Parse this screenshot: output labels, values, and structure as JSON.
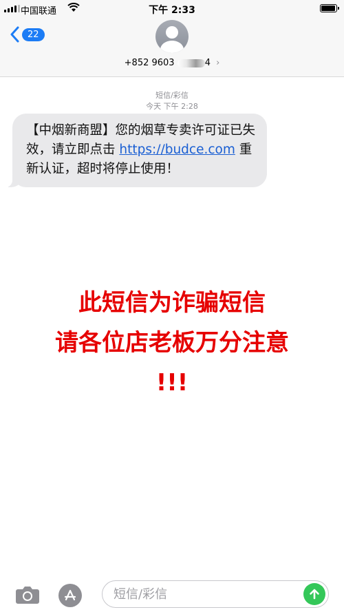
{
  "status_bar": {
    "carrier": "中国联通",
    "time": "下午 2:33",
    "battery_level": 0.95
  },
  "header": {
    "back_count": "22",
    "contact_prefix": "+852 9603",
    "contact_suffix": "4",
    "contact_chevron": "›"
  },
  "conversation": {
    "message_type": "短信/彩信",
    "timestamp": "今天 下午 2:28",
    "message": {
      "part1": "【中烟新商盟】您的烟草专卖许可证已失效，请立即点击 ",
      "link": "https://budce.com",
      "part2": " 重新认证，超时将停止使用！"
    }
  },
  "overlay": {
    "line1": "此短信为诈骗短信",
    "line2": "请各位店老板万分注意",
    "line3": "!!!"
  },
  "input_bar": {
    "placeholder": "短信/彩信"
  },
  "colors": {
    "accent": "#1c7cf5",
    "link": "#1a5fd3",
    "warning": "#e60000",
    "send": "#34c759",
    "bubble": "#e9e9eb"
  },
  "icons": {
    "signal": "signal-icon",
    "wifi": "wifi-icon",
    "battery": "battery-icon",
    "back": "chevron-left-icon",
    "avatar": "person-icon",
    "camera": "camera-icon",
    "apps": "app-store-icon",
    "send": "arrow-up-icon"
  }
}
